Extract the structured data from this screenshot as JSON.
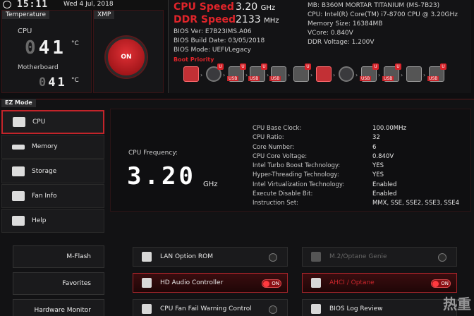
{
  "topbar": {
    "time": "15:11",
    "date": "Wed 4 Jul, 2018"
  },
  "temperature": {
    "tab": "Temperature",
    "cpu_label": "CPU",
    "cpu_value": "41",
    "unit": "°C",
    "mb_label": "Motherboard",
    "mb_value": "41"
  },
  "xmp": {
    "tab": "XMP",
    "button": "ON"
  },
  "speeds": {
    "cpu_label": "CPU Speed",
    "cpu_value": "3.20",
    "cpu_unit": "GHz",
    "ddr_label": "DDR Speed",
    "ddr_value": "2133",
    "ddr_unit": "MHz"
  },
  "bios": {
    "ver": "BIOS Ver: E7B23IMS.A06",
    "build": "BIOS Build Date: 03/05/2018",
    "mode": "BIOS Mode: UEFI/Legacy",
    "boot_priority": "Boot Priority"
  },
  "sysinfo": {
    "mb": "MB: B360M MORTAR TITANIUM (MS-7B23)",
    "cpu": "CPU: Intel(R) Core(TM) i7-8700 CPU @ 3.20GHz",
    "mem": "Memory Size: 16384MB",
    "vcore": "VCore: 0.840V",
    "ddrv": "DDR Voltage: 1.200V"
  },
  "boot": {
    "usb": "USB",
    "u": "U"
  },
  "ez": {
    "label": "EZ Mode"
  },
  "sidebar": [
    {
      "label": "CPU"
    },
    {
      "label": "Memory"
    },
    {
      "label": "Storage"
    },
    {
      "label": "Fan Info"
    },
    {
      "label": "Help"
    }
  ],
  "cpu": {
    "freq_label": "CPU Frequency:",
    "freq_value": "3.20",
    "freq_unit": "GHz",
    "specs": [
      {
        "k": "CPU Base Clock:",
        "v": "100.00MHz"
      },
      {
        "k": "CPU Ratio:",
        "v": "32"
      },
      {
        "k": "Core Number:",
        "v": "6"
      },
      {
        "k": "CPU Core Voltage:",
        "v": "0.840V"
      },
      {
        "k": "Intel Turbo Boost Technology:",
        "v": "YES"
      },
      {
        "k": "Hyper-Threading Technology:",
        "v": "YES"
      },
      {
        "k": "Intel Virtualization Technology:",
        "v": "Enabled"
      },
      {
        "k": "Execute Disable Bit:",
        "v": "Enabled"
      },
      {
        "k": "Instruction Set:",
        "v": "MMX, SSE, SSE2, SSE3, SSE4"
      }
    ]
  },
  "tools": {
    "mflash": "M-Flash",
    "favorites": "Favorites",
    "hwmon": "Hardware Monitor"
  },
  "options": {
    "lan": "LAN Option ROM",
    "hda": "HD Audio Controller",
    "fan": "CPU Fan Fail Warning Control",
    "m2": "M.2/Optane Genie",
    "ahci": "AHCI / Optane",
    "bioslog": "BIOS Log Review",
    "on": "ON"
  },
  "watermark": "热重"
}
